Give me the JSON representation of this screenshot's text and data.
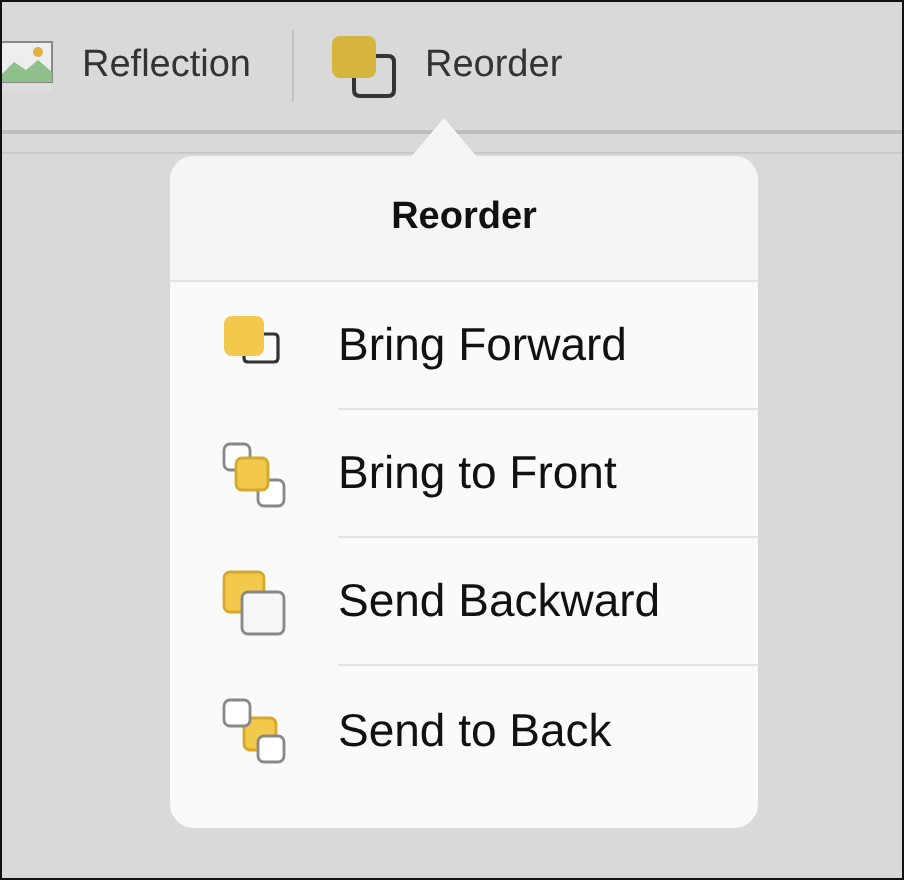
{
  "toolbar": {
    "items": [
      {
        "label": "Reflection",
        "kind": "reflection",
        "selected": false
      },
      {
        "label": "Reorder",
        "kind": "reorder",
        "selected": true
      }
    ]
  },
  "popover": {
    "title": "Reorder",
    "items": [
      {
        "label": "Bring Forward",
        "kind": "forward"
      },
      {
        "label": "Bring to Front",
        "kind": "front"
      },
      {
        "label": "Send Backward",
        "kind": "backward"
      },
      {
        "label": "Send to Back",
        "kind": "back"
      }
    ]
  }
}
